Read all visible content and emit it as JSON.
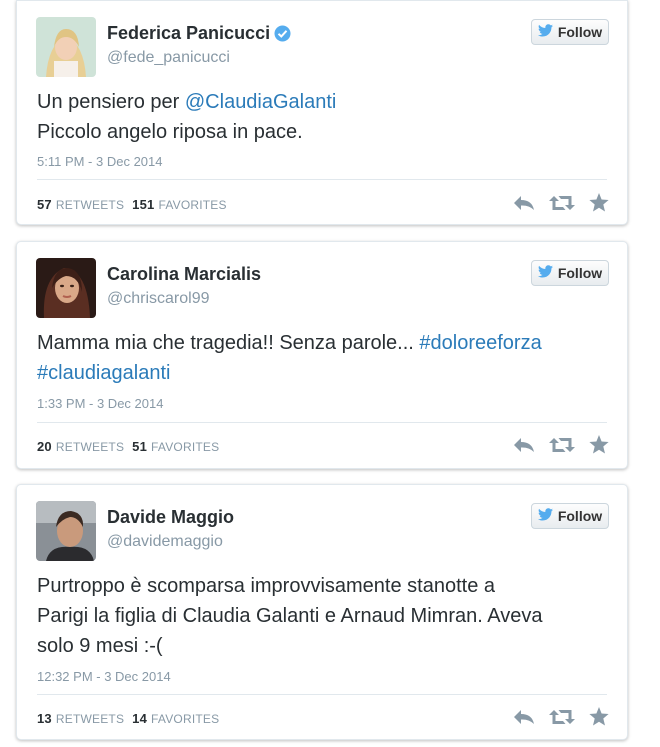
{
  "tweets": [
    {
      "name": "Federica Panicucci",
      "verified": true,
      "handle": "@fede_panicucci",
      "follow_label": "Follow",
      "text_lines": [
        "Un pensiero per ",
        "@ClaudiaGalanti",
        "Piccolo angelo riposa in pace."
      ],
      "timestamp": "5:11 PM - 3 Dec 2014",
      "retweets": "57",
      "retweets_label": "RETWEETS",
      "favorites": "151",
      "favorites_label": "FAVORITES"
    },
    {
      "name": "Carolina Marcialis",
      "verified": false,
      "handle": "@chriscarol99",
      "follow_label": "Follow",
      "text_lines": [
        "Mamma mia che tragedia!! Senza parole... ",
        "#doloreeforza",
        "#claudiagalanti"
      ],
      "timestamp": "1:33 PM - 3 Dec 2014",
      "retweets": "20",
      "retweets_label": "RETWEETS",
      "favorites": "51",
      "favorites_label": "FAVORITES"
    },
    {
      "name": "Davide Maggio",
      "verified": false,
      "handle": "@davidemaggio",
      "follow_label": "Follow",
      "text_lines": [
        "Purtroppo è scomparsa improvvisamente stanotte a",
        "Parigi la figlia di Claudia Galanti e Arnaud Mimran. Aveva",
        "solo 9 mesi :-("
      ],
      "timestamp": "12:32 PM - 3 Dec 2014",
      "retweets": "13",
      "retweets_label": "RETWEETS",
      "favorites": "14",
      "favorites_label": "FAVORITES"
    }
  ],
  "colors": {
    "link": "#2b7bb9",
    "verified": "#55acee",
    "twitter_bird": "#55acee"
  },
  "icons": [
    "twitter-bird-icon",
    "verified-badge-icon",
    "reply-icon",
    "retweet-icon",
    "favorite-star-icon"
  ]
}
